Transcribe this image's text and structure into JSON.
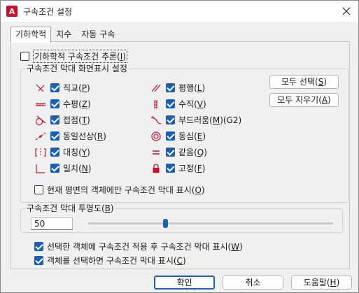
{
  "window": {
    "title": "구속조건 설정",
    "app_icon_letter": "A"
  },
  "tabs": [
    {
      "label": "기하학적",
      "active": true
    },
    {
      "label": "치수",
      "active": false
    },
    {
      "label": "자동 구속",
      "active": false
    }
  ],
  "infer": {
    "label_pre": "기하학적 구속조건 추론(",
    "key": "I",
    "label_post": ")",
    "checked": false
  },
  "bar_group": {
    "label": "구속조건 막대 화면표시 설정"
  },
  "constraints_left": [
    {
      "icon": "perpendicular-icon",
      "name": "직교",
      "key": "P",
      "checked": true
    },
    {
      "icon": "horizontal-icon",
      "name": "수평",
      "key": "Z",
      "checked": true
    },
    {
      "icon": "tangent-icon",
      "name": "접점",
      "key": "T",
      "checked": true
    },
    {
      "icon": "collinear-icon",
      "name": "동일선상",
      "key": "R",
      "checked": true
    },
    {
      "icon": "symmetric-icon",
      "name": "대칭",
      "key": "Y",
      "checked": true
    },
    {
      "icon": "coincident-icon",
      "name": "일치",
      "key": "N",
      "checked": true
    }
  ],
  "constraints_right": [
    {
      "icon": "parallel-icon",
      "name": "평행",
      "key": "L",
      "suffix": "",
      "checked": true
    },
    {
      "icon": "vertical-icon",
      "name": "수직",
      "key": "V",
      "suffix": "",
      "checked": true
    },
    {
      "icon": "smooth-icon",
      "name": "부드러움",
      "key": "M",
      "suffix": "(G2)",
      "checked": true
    },
    {
      "icon": "concentric-icon",
      "name": "동심",
      "key": "E",
      "suffix": "",
      "checked": true
    },
    {
      "icon": "equal-icon",
      "name": "같음",
      "key": "Q",
      "suffix": "",
      "checked": true
    },
    {
      "icon": "fix-lock-icon",
      "name": "고정",
      "key": "F",
      "suffix": "",
      "checked": true
    }
  ],
  "buttons_side": {
    "select_all": {
      "pre": "모두 선택(",
      "key": "S",
      "post": ")"
    },
    "clear_all": {
      "pre": "모두 지우기(",
      "key": "A",
      "post": ")"
    }
  },
  "current_plane": {
    "pre": "현재 평면의 객체에만 구속조건 막대 표시(",
    "key": "O",
    "post": ")",
    "checked": false
  },
  "transparency": {
    "label_pre": "구속조건 막대 투명도(",
    "key": "B",
    "label_post": ")",
    "value": "50",
    "slider_level": 0.5
  },
  "after_apply": {
    "pre": "선택한 객체에 구속조건 적용 후 구속조건 막대 표시(",
    "key": "W",
    "post": ")",
    "checked": true
  },
  "when_selected": {
    "pre": "객체를 선택하면 구속조건 막대 표시(",
    "key": "C",
    "post": ")",
    "checked": true
  },
  "footer": {
    "ok": "확인",
    "cancel": "취소",
    "help_pre": "도움말(",
    "help_key": "H",
    "help_post": ")"
  },
  "colors": {
    "accent": "#1a5fb4",
    "icon_red": "#c8102e"
  }
}
